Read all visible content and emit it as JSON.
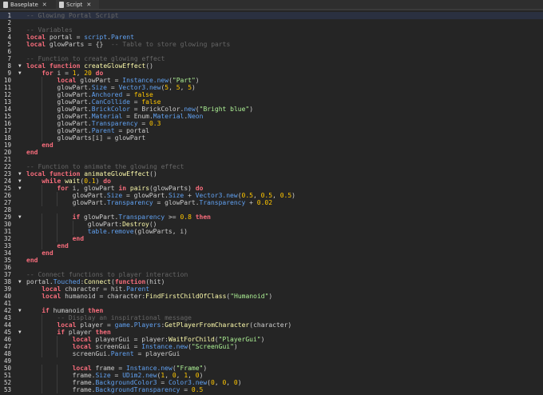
{
  "tabs": [
    {
      "label": "Baseplate",
      "close": "✕",
      "icon": "baseplate-icon"
    },
    {
      "label": "Script",
      "close": "✕",
      "icon": "script-icon",
      "active": true
    }
  ],
  "colors": {
    "keyword": "#f86d7c",
    "comment": "#666666",
    "property": "#61a1f1",
    "function": "#fdfbac",
    "number": "#ffc600",
    "string": "#adf195"
  },
  "current_line": 1,
  "fold_lines": [
    8,
    9,
    23,
    24,
    25,
    29,
    38,
    42,
    45
  ],
  "lines": [
    {
      "i": 0,
      "t": [
        [
          "c",
          "-- Glowing Portal Script"
        ]
      ]
    },
    {
      "i": 0,
      "t": []
    },
    {
      "i": 0,
      "t": [
        [
          "c",
          "-- Variables"
        ]
      ]
    },
    {
      "i": 0,
      "t": [
        [
          "k",
          "local"
        ],
        [
          "t",
          " portal = "
        ],
        [
          "p",
          "script"
        ],
        [
          "t",
          "."
        ],
        [
          "p",
          "Parent"
        ]
      ]
    },
    {
      "i": 0,
      "t": [
        [
          "k",
          "local"
        ],
        [
          "t",
          " glowParts = {}  "
        ],
        [
          "c",
          "-- Table to store glowing parts"
        ]
      ]
    },
    {
      "i": 0,
      "t": []
    },
    {
      "i": 0,
      "t": [
        [
          "c",
          "-- Function to create glowing effect"
        ]
      ]
    },
    {
      "i": 0,
      "t": [
        [
          "k",
          "local function"
        ],
        [
          "t",
          " "
        ],
        [
          "f",
          "createGlowEffect"
        ],
        [
          "t",
          "()"
        ]
      ]
    },
    {
      "i": 1,
      "t": [
        [
          "k",
          "for"
        ],
        [
          "t",
          " i = "
        ],
        [
          "n",
          "1"
        ],
        [
          "t",
          ", "
        ],
        [
          "n",
          "20"
        ],
        [
          "k",
          " do"
        ]
      ]
    },
    {
      "i": 2,
      "t": [
        [
          "k",
          "local"
        ],
        [
          "t",
          " glowPart = "
        ],
        [
          "p",
          "Instance.new"
        ],
        [
          "t",
          "("
        ],
        [
          "s",
          "\"Part\""
        ],
        [
          "t",
          ")"
        ]
      ]
    },
    {
      "i": 2,
      "t": [
        [
          "t",
          "glowPart."
        ],
        [
          "p",
          "Size"
        ],
        [
          "t",
          " = "
        ],
        [
          "p",
          "Vector3.new"
        ],
        [
          "t",
          "("
        ],
        [
          "n",
          "5"
        ],
        [
          "t",
          ", "
        ],
        [
          "n",
          "5"
        ],
        [
          "t",
          ", "
        ],
        [
          "n",
          "5"
        ],
        [
          "t",
          ")"
        ]
      ]
    },
    {
      "i": 2,
      "t": [
        [
          "t",
          "glowPart."
        ],
        [
          "p",
          "Anchored"
        ],
        [
          "t",
          " = "
        ],
        [
          "n",
          "false"
        ]
      ]
    },
    {
      "i": 2,
      "t": [
        [
          "t",
          "glowPart."
        ],
        [
          "p",
          "CanCollide"
        ],
        [
          "t",
          " = "
        ],
        [
          "n",
          "false"
        ]
      ]
    },
    {
      "i": 2,
      "t": [
        [
          "t",
          "glowPart."
        ],
        [
          "p",
          "BrickColor"
        ],
        [
          "t",
          " = BrickColor."
        ],
        [
          "p",
          "new"
        ],
        [
          "t",
          "("
        ],
        [
          "s",
          "\"Bright blue\""
        ],
        [
          "t",
          ")"
        ]
      ]
    },
    {
      "i": 2,
      "t": [
        [
          "t",
          "glowPart."
        ],
        [
          "p",
          "Material"
        ],
        [
          "t",
          " = Enum."
        ],
        [
          "p",
          "Material"
        ],
        [
          "t",
          "."
        ],
        [
          "p",
          "Neon"
        ]
      ]
    },
    {
      "i": 2,
      "t": [
        [
          "t",
          "glowPart."
        ],
        [
          "p",
          "Transparency"
        ],
        [
          "t",
          " = "
        ],
        [
          "n",
          "0.3"
        ]
      ]
    },
    {
      "i": 2,
      "t": [
        [
          "t",
          "glowPart."
        ],
        [
          "p",
          "Parent"
        ],
        [
          "t",
          " = portal"
        ]
      ]
    },
    {
      "i": 2,
      "t": [
        [
          "t",
          "glowParts[i] = glowPart"
        ]
      ]
    },
    {
      "i": 1,
      "t": [
        [
          "k",
          "end"
        ]
      ]
    },
    {
      "i": 0,
      "t": [
        [
          "k",
          "end"
        ]
      ]
    },
    {
      "i": 0,
      "t": []
    },
    {
      "i": 0,
      "t": [
        [
          "c",
          "-- Function to animate the glowing effect"
        ]
      ]
    },
    {
      "i": 0,
      "t": [
        [
          "k",
          "local function"
        ],
        [
          "t",
          " "
        ],
        [
          "f",
          "animateGlowEffect"
        ],
        [
          "t",
          "()"
        ]
      ]
    },
    {
      "i": 1,
      "t": [
        [
          "k",
          "while"
        ],
        [
          "t",
          " "
        ],
        [
          "f",
          "wait"
        ],
        [
          "t",
          "("
        ],
        [
          "n",
          "0.1"
        ],
        [
          "t",
          ") "
        ],
        [
          "k",
          "do"
        ]
      ]
    },
    {
      "i": 2,
      "t": [
        [
          "k",
          "for"
        ],
        [
          "t",
          " i, glowPart "
        ],
        [
          "k",
          "in"
        ],
        [
          "t",
          " "
        ],
        [
          "f",
          "pairs"
        ],
        [
          "t",
          "(glowParts) "
        ],
        [
          "k",
          "do"
        ]
      ]
    },
    {
      "i": 3,
      "t": [
        [
          "t",
          "glowPart."
        ],
        [
          "p",
          "Size"
        ],
        [
          "t",
          " = glowPart."
        ],
        [
          "p",
          "Size"
        ],
        [
          "t",
          " + "
        ],
        [
          "p",
          "Vector3.new"
        ],
        [
          "t",
          "("
        ],
        [
          "n",
          "0.5"
        ],
        [
          "t",
          ", "
        ],
        [
          "n",
          "0.5"
        ],
        [
          "t",
          ", "
        ],
        [
          "n",
          "0.5"
        ],
        [
          "t",
          ")"
        ]
      ]
    },
    {
      "i": 3,
      "t": [
        [
          "t",
          "glowPart."
        ],
        [
          "p",
          "Transparency"
        ],
        [
          "t",
          " = glowPart."
        ],
        [
          "p",
          "Transparency"
        ],
        [
          "t",
          " + "
        ],
        [
          "n",
          "0.02"
        ]
      ]
    },
    {
      "i": 0,
      "t": []
    },
    {
      "i": 3,
      "t": [
        [
          "k",
          "if"
        ],
        [
          "t",
          " glowPart."
        ],
        [
          "p",
          "Transparency"
        ],
        [
          "t",
          " >= "
        ],
        [
          "n",
          "0.8"
        ],
        [
          "t",
          " "
        ],
        [
          "k",
          "then"
        ]
      ]
    },
    {
      "i": 4,
      "t": [
        [
          "t",
          "glowPart:"
        ],
        [
          "f",
          "Destroy"
        ],
        [
          "t",
          "()"
        ]
      ]
    },
    {
      "i": 4,
      "t": [
        [
          "p",
          "table.remove"
        ],
        [
          "t",
          "(glowParts, i)"
        ]
      ]
    },
    {
      "i": 3,
      "t": [
        [
          "k",
          "end"
        ]
      ]
    },
    {
      "i": 2,
      "t": [
        [
          "k",
          "end"
        ]
      ]
    },
    {
      "i": 1,
      "t": [
        [
          "k",
          "end"
        ]
      ]
    },
    {
      "i": 0,
      "t": [
        [
          "k",
          "end"
        ]
      ]
    },
    {
      "i": 0,
      "t": []
    },
    {
      "i": 0,
      "t": [
        [
          "c",
          "-- Connect functions to player interaction"
        ]
      ]
    },
    {
      "i": 0,
      "t": [
        [
          "t",
          "portal."
        ],
        [
          "p",
          "Touched"
        ],
        [
          "t",
          ":"
        ],
        [
          "f",
          "Connect"
        ],
        [
          "t",
          "("
        ],
        [
          "k",
          "function"
        ],
        [
          "t",
          "(hit)"
        ]
      ]
    },
    {
      "i": 1,
      "t": [
        [
          "k",
          "local"
        ],
        [
          "t",
          " character = hit."
        ],
        [
          "p",
          "Parent"
        ]
      ]
    },
    {
      "i": 1,
      "t": [
        [
          "k",
          "local"
        ],
        [
          "t",
          " humanoid = character:"
        ],
        [
          "f",
          "FindFirstChildOfClass"
        ],
        [
          "t",
          "("
        ],
        [
          "s",
          "\"Humanoid\""
        ],
        [
          "t",
          ")"
        ]
      ]
    },
    {
      "i": 0,
      "t": []
    },
    {
      "i": 1,
      "t": [
        [
          "k",
          "if"
        ],
        [
          "t",
          " humanoid "
        ],
        [
          "k",
          "then"
        ]
      ]
    },
    {
      "i": 2,
      "t": [
        [
          "c",
          "-- Display an inspirational message"
        ]
      ]
    },
    {
      "i": 2,
      "t": [
        [
          "k",
          "local"
        ],
        [
          "t",
          " player = "
        ],
        [
          "p",
          "game"
        ],
        [
          "t",
          "."
        ],
        [
          "p",
          "Players"
        ],
        [
          "t",
          ":"
        ],
        [
          "f",
          "GetPlayerFromCharacter"
        ],
        [
          "t",
          "(character)"
        ]
      ]
    },
    {
      "i": 2,
      "t": [
        [
          "k",
          "if"
        ],
        [
          "t",
          " player "
        ],
        [
          "k",
          "then"
        ]
      ]
    },
    {
      "i": 3,
      "t": [
        [
          "k",
          "local"
        ],
        [
          "t",
          " playerGui = player:"
        ],
        [
          "f",
          "WaitForChild"
        ],
        [
          "t",
          "("
        ],
        [
          "s",
          "\"PlayerGui\""
        ],
        [
          "t",
          ")"
        ]
      ]
    },
    {
      "i": 3,
      "t": [
        [
          "k",
          "local"
        ],
        [
          "t",
          " screenGui = "
        ],
        [
          "p",
          "Instance.new"
        ],
        [
          "t",
          "("
        ],
        [
          "s",
          "\"ScreenGui\""
        ],
        [
          "t",
          ")"
        ]
      ]
    },
    {
      "i": 3,
      "t": [
        [
          "t",
          "screenGui."
        ],
        [
          "p",
          "Parent"
        ],
        [
          "t",
          " = playerGui"
        ]
      ]
    },
    {
      "i": 0,
      "t": []
    },
    {
      "i": 3,
      "t": [
        [
          "k",
          "local"
        ],
        [
          "t",
          " frame = "
        ],
        [
          "p",
          "Instance.new"
        ],
        [
          "t",
          "("
        ],
        [
          "s",
          "\"Frame\""
        ],
        [
          "t",
          ")"
        ]
      ]
    },
    {
      "i": 3,
      "t": [
        [
          "t",
          "frame."
        ],
        [
          "p",
          "Size"
        ],
        [
          "t",
          " = "
        ],
        [
          "p",
          "UDim2.new"
        ],
        [
          "t",
          "("
        ],
        [
          "n",
          "1"
        ],
        [
          "t",
          ", "
        ],
        [
          "n",
          "0"
        ],
        [
          "t",
          ", "
        ],
        [
          "n",
          "1"
        ],
        [
          "t",
          ", "
        ],
        [
          "n",
          "0"
        ],
        [
          "t",
          ")"
        ]
      ]
    },
    {
      "i": 3,
      "t": [
        [
          "t",
          "frame."
        ],
        [
          "p",
          "BackgroundColor3"
        ],
        [
          "t",
          " = "
        ],
        [
          "p",
          "Color3.new"
        ],
        [
          "t",
          "("
        ],
        [
          "n",
          "0"
        ],
        [
          "t",
          ", "
        ],
        [
          "n",
          "0"
        ],
        [
          "t",
          ", "
        ],
        [
          "n",
          "0"
        ],
        [
          "t",
          ")"
        ]
      ]
    },
    {
      "i": 3,
      "t": [
        [
          "t",
          "frame."
        ],
        [
          "p",
          "BackgroundTransparency"
        ],
        [
          "t",
          " = "
        ],
        [
          "n",
          "0.5"
        ]
      ]
    }
  ]
}
